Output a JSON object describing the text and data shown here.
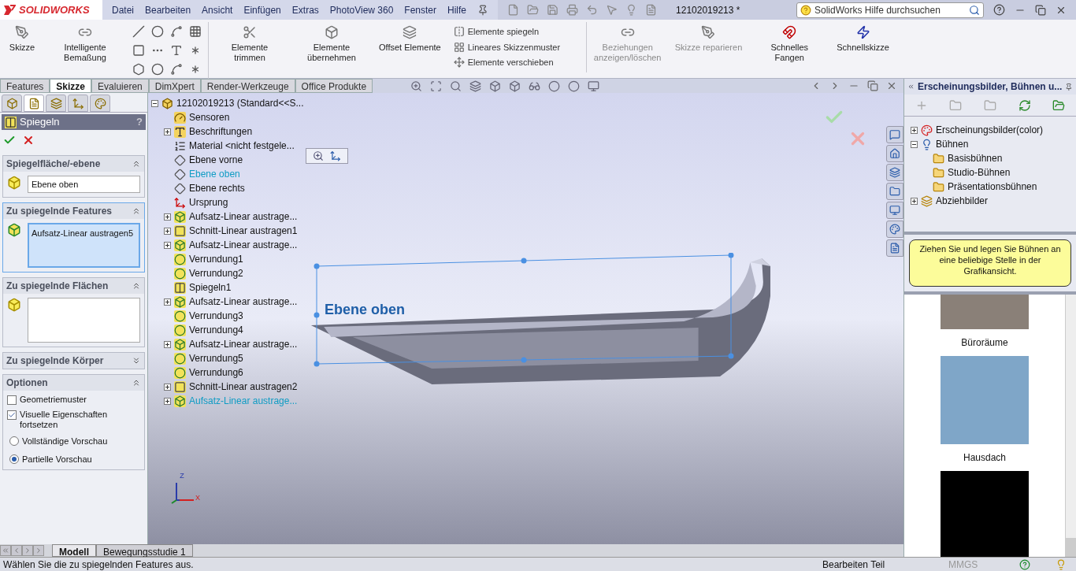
{
  "app": {
    "logo": "SOLIDWORKS"
  },
  "menu": [
    "Datei",
    "Bearbeiten",
    "Ansicht",
    "Einfügen",
    "Extras",
    "PhotoView 360",
    "Fenster",
    "Hilfe"
  ],
  "document_title": "12102019213 *",
  "search": {
    "placeholder": "SolidWorks Hilfe durchsuchen"
  },
  "ribbon": {
    "tools": [
      {
        "kind": "sketch",
        "label": "Skizze",
        "disabled": false
      },
      {
        "kind": "dimension",
        "label": "Intelligente Bemaßung",
        "disabled": false
      },
      {
        "kind": "grid"
      },
      {
        "kind": "trim",
        "label": "Elemente trimmen",
        "disabled": false
      },
      {
        "kind": "convert",
        "label": "Elemente übernehmen",
        "disabled": false
      },
      {
        "kind": "offset",
        "label": "Offset Elemente",
        "disabled": false
      },
      {
        "kind": "list",
        "items": [
          "Elemente spiegeln",
          "Lineares Skizzenmuster",
          "Elemente verschieben"
        ]
      },
      {
        "kind": "relations",
        "label": "Beziehungen anzeigen/löschen",
        "disabled": true
      },
      {
        "kind": "repair",
        "label": "Skizze reparieren",
        "disabled": true
      },
      {
        "kind": "snap",
        "label": "Schnelles Fangen",
        "disabled": false
      },
      {
        "kind": "quick",
        "label": "Schnellskizze",
        "disabled": false
      }
    ]
  },
  "command_tabs": [
    {
      "label": "Features",
      "selected": false
    },
    {
      "label": "Skizze",
      "selected": true
    },
    {
      "label": "Evaluieren",
      "selected": false
    },
    {
      "label": "DimXpert",
      "selected": false
    },
    {
      "label": "Render-Werkzeuge",
      "selected": false
    },
    {
      "label": "Office Produkte",
      "selected": false
    }
  ],
  "property_manager": {
    "tabs": [
      {
        "selected": false
      },
      {
        "selected": true
      },
      {
        "selected": false
      },
      {
        "selected": false
      },
      {
        "selected": false
      }
    ],
    "title": "Spiegeln",
    "help": "?",
    "sections": [
      {
        "title": "Spiegelfläche/-ebene",
        "expanded": true,
        "kind": "face-field",
        "value": "Ebene oben",
        "active": false
      },
      {
        "title": "Zu spiegelnde Features",
        "expanded": true,
        "kind": "feature-list",
        "items": [
          "Aufsatz-Linear austragen5"
        ],
        "active": true
      },
      {
        "title": "Zu spiegelnde Flächen",
        "expanded": true,
        "kind": "face-list",
        "active": false
      },
      {
        "title": "Zu spiegelnde Körper",
        "expanded": false,
        "kind": "body-list",
        "active": false
      },
      {
        "title": "Optionen",
        "expanded": true,
        "kind": "options",
        "active": false,
        "options": [
          {
            "kind": "checkbox",
            "label": "Geometriemuster",
            "checked": false
          },
          {
            "kind": "checkbox",
            "label": "Visuelle Eigenschaften fortsetzen",
            "checked": true
          },
          {
            "kind": "radio",
            "label": "Vollständige Vorschau",
            "selected": false
          },
          {
            "kind": "radio",
            "label": "Partielle Vorschau",
            "selected": true
          }
        ]
      }
    ]
  },
  "feature_tree": {
    "root": "12102019213  (Standard<<S...",
    "expanded": true,
    "children": [
      {
        "kind": "sensor",
        "label": "Sensoren",
        "expandable": false,
        "highlighted": false
      },
      {
        "kind": "annotation",
        "label": "Beschriftungen",
        "expandable": true,
        "highlighted": false
      },
      {
        "kind": "material",
        "label": "Material <nicht festgele...",
        "expandable": false,
        "highlighted": false
      },
      {
        "kind": "plane",
        "label": "Ebene vorne",
        "expandable": false,
        "highlighted": false
      },
      {
        "kind": "plane",
        "label": "Ebene oben",
        "expandable": false,
        "highlighted": true
      },
      {
        "kind": "plane",
        "label": "Ebene rechts",
        "expandable": false,
        "highlighted": false
      },
      {
        "kind": "origin",
        "label": "Ursprung",
        "expandable": false,
        "highlighted": false
      },
      {
        "kind": "boss",
        "label": "Aufsatz-Linear austrage...",
        "expandable": true,
        "highlighted": false
      },
      {
        "kind": "cut",
        "label": "Schnitt-Linear austragen1",
        "expandable": true,
        "highlighted": false
      },
      {
        "kind": "boss",
        "label": "Aufsatz-Linear austrage...",
        "expandable": true,
        "highlighted": false
      },
      {
        "kind": "fillet",
        "label": "Verrundung1",
        "expandable": false,
        "highlighted": false
      },
      {
        "kind": "fillet",
        "label": "Verrundung2",
        "expandable": false,
        "highlighted": false
      },
      {
        "kind": "mirror",
        "label": "Spiegeln1",
        "expandable": false,
        "highlighted": false
      },
      {
        "kind": "boss",
        "label": "Aufsatz-Linear austrage...",
        "expandable": true,
        "highlighted": false
      },
      {
        "kind": "fillet",
        "label": "Verrundung3",
        "expandable": false,
        "highlighted": false
      },
      {
        "kind": "fillet",
        "label": "Verrundung4",
        "expandable": false,
        "highlighted": false
      },
      {
        "kind": "boss",
        "label": "Aufsatz-Linear austrage...",
        "expandable": true,
        "highlighted": false
      },
      {
        "kind": "fillet",
        "label": "Verrundung5",
        "expandable": false,
        "highlighted": false
      },
      {
        "kind": "fillet",
        "label": "Verrundung6",
        "expandable": false,
        "highlighted": false
      },
      {
        "kind": "cut",
        "label": "Schnitt-Linear austragen2",
        "expandable": true,
        "highlighted": false
      },
      {
        "kind": "boss",
        "label": "Aufsatz-Linear austrage...",
        "expandable": true,
        "highlighted": true
      }
    ]
  },
  "viewport": {
    "plane_label": "Ebene oben",
    "triad": [
      "Z",
      "X"
    ]
  },
  "task_pane": {
    "title": "Erscheinungsbilder, Bühnen u...",
    "tree": [
      {
        "kind": "appearance",
        "label": "Erscheinungsbilder(color)",
        "expanded": false
      },
      {
        "kind": "scene",
        "label": "Bühnen",
        "expanded": true,
        "children": [
          {
            "label": "Basisbühnen"
          },
          {
            "label": "Studio-Bühnen"
          },
          {
            "label": "Präsentationsbühnen"
          }
        ]
      },
      {
        "kind": "decal",
        "label": "Abziehbilder",
        "expanded": false
      }
    ],
    "hint": "Ziehen Sie und legen Sie Bühnen an eine beliebige Stelle in der Grafikansicht.",
    "thumbnails": [
      {
        "label": "Büroräume",
        "color": "#8a8078"
      },
      {
        "label": "Hausdach",
        "color": "#7fa6c8"
      },
      {
        "color": "#000000"
      }
    ]
  },
  "bottom_tabs": [
    {
      "label": "Modell",
      "selected": true
    },
    {
      "label": "Bewegungsstudie 1",
      "selected": false
    }
  ],
  "status_bar": {
    "message": "Wählen Sie die zu spiegelnden Features aus.",
    "mode": "Bearbeiten Teil",
    "units": "MMGS"
  }
}
